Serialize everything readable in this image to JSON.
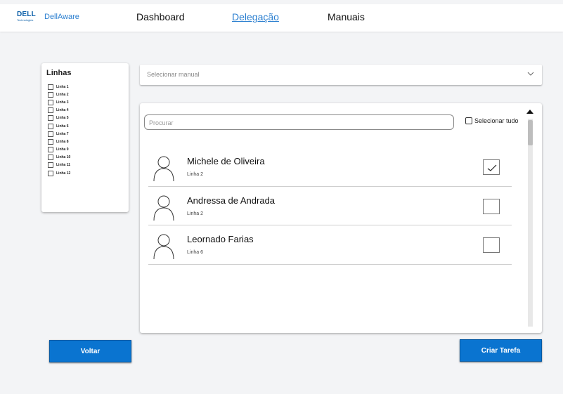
{
  "header": {
    "logo_text": "DELL",
    "logo_sub": "Technologies",
    "brand": "DellAware",
    "nav": [
      {
        "label": "Dashboard",
        "active": false
      },
      {
        "label": "Delegação",
        "active": true
      },
      {
        "label": "Manuais",
        "active": false
      }
    ]
  },
  "filters": {
    "title": "Linhas",
    "items": [
      "Linha 1",
      "Linha 2",
      "Linha 3",
      "Linha 4",
      "Linha 5",
      "Linha 6",
      "Linha 7",
      "Linha 8",
      "Linha 9",
      "Linha 10",
      "Linha 11",
      "Linha 12"
    ]
  },
  "manual_select": {
    "placeholder": "Selecionar manual"
  },
  "panel": {
    "search_placeholder": "Procurar",
    "select_all_label": "Selecionar tudo",
    "people": [
      {
        "name": "Michele de Oliveira",
        "line": "Linha 2",
        "checked": true
      },
      {
        "name": "Andressa de Andrada",
        "line": "Linha 2",
        "checked": false
      },
      {
        "name": "Leornado Farias",
        "line": "Linha 6",
        "checked": false
      }
    ]
  },
  "actions": {
    "back_label": "Voltar",
    "create_label": "Criar Tarefa"
  },
  "colors": {
    "accent": "#0a74d0",
    "link": "#2b7fd0"
  }
}
